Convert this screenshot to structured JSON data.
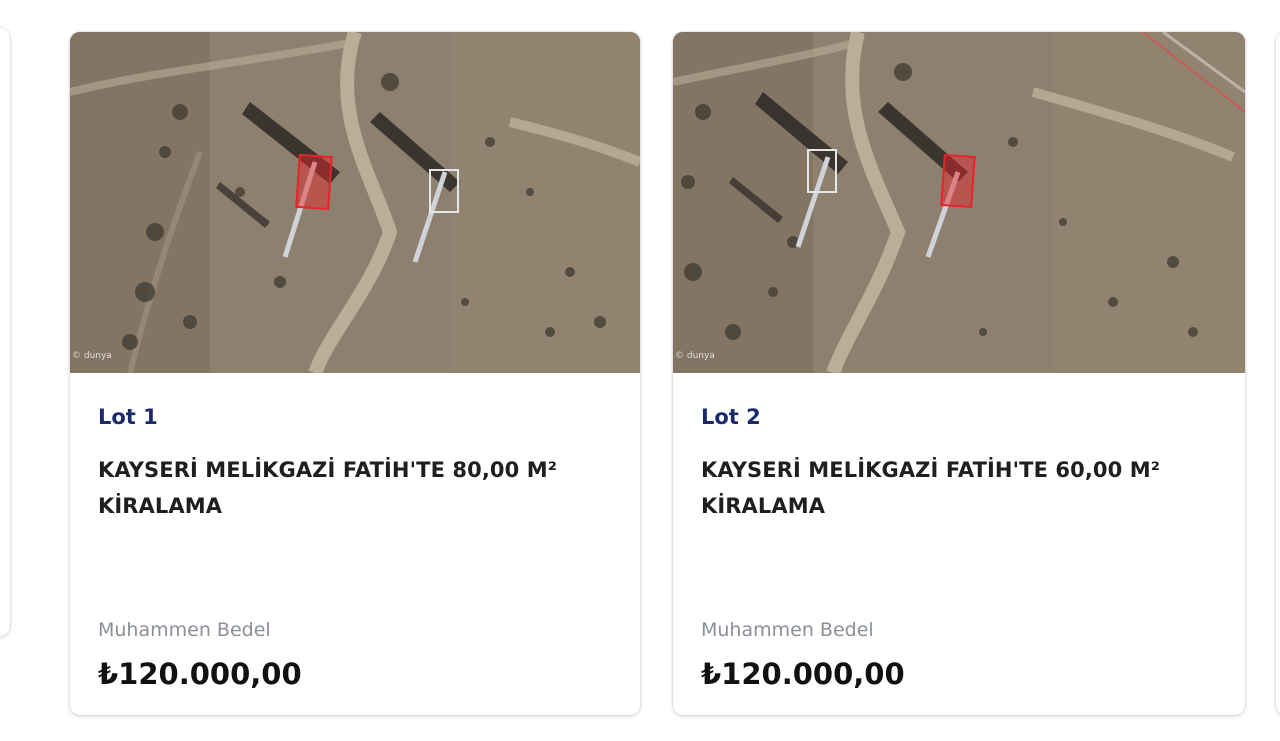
{
  "map_credit": "© dunya",
  "lots": [
    {
      "lot_label": "Lot 1",
      "title": "KAYSERİ MELİKGAZİ FATİH'TE 80,00 M² KİRALAMA",
      "price_label": "Muhammen Bedel",
      "price": "₺120.000,00"
    },
    {
      "lot_label": "Lot 2",
      "title": "KAYSERİ MELİKGAZİ FATİH'TE 60,00 M² KİRALAMA",
      "price_label": "Muhammen Bedel",
      "price": "₺120.000,00"
    }
  ],
  "colors": {
    "lot_label": "#1b2a6b",
    "title": "#1f1f1f",
    "price_label": "#8a8f98",
    "price": "#111111",
    "highlight": "#e8232a"
  }
}
